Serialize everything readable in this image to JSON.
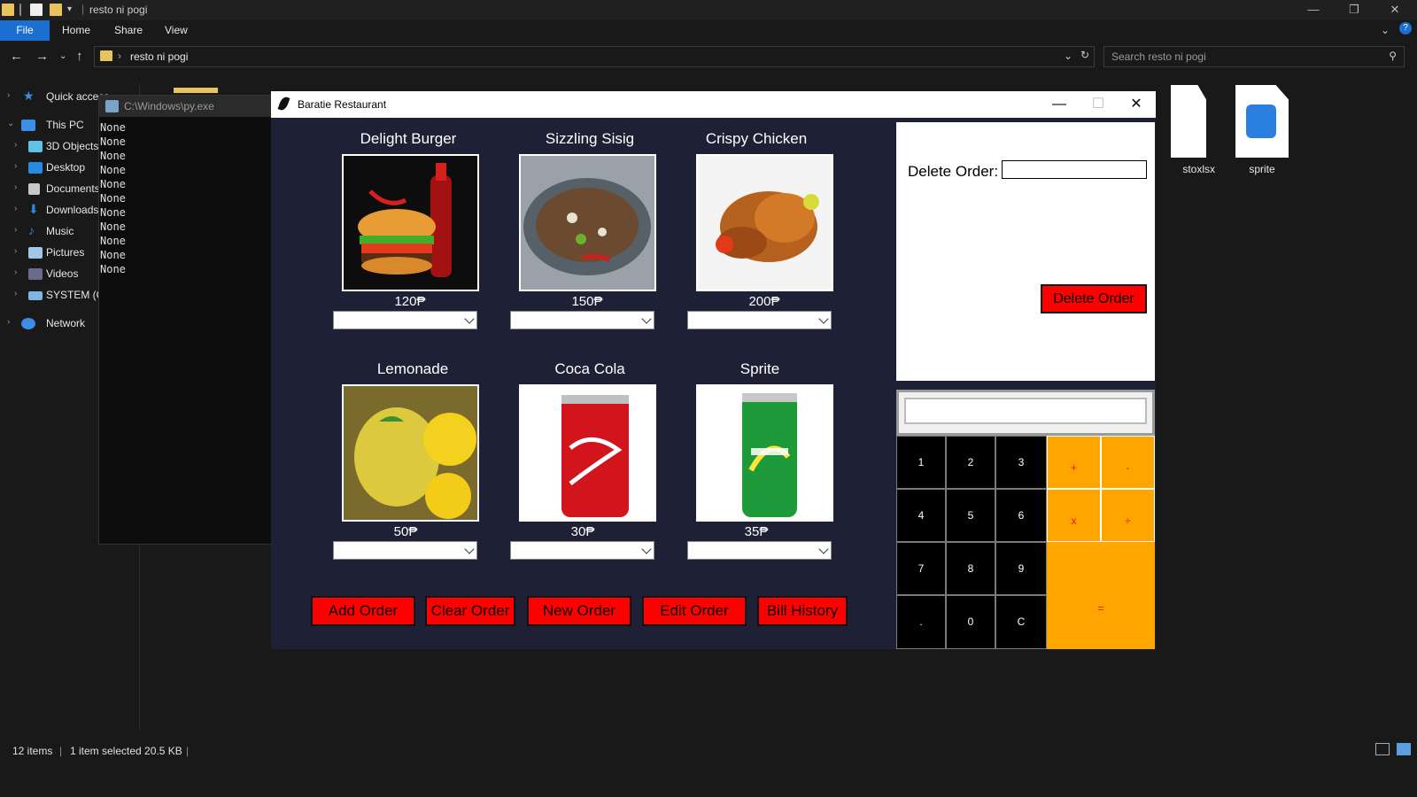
{
  "explorer": {
    "title": "resto ni pogi",
    "tabs": {
      "file": "File",
      "home": "Home",
      "share": "Share",
      "view": "View"
    },
    "address": "resto ni pogi",
    "search_placeholder": "Search resto ni pogi",
    "nav": {
      "quick_access": "Quick access",
      "this_pc": "This PC",
      "objects3d": "3D Objects",
      "desktop": "Desktop",
      "documents": "Documents",
      "downloads": "Downloads",
      "music": "Music",
      "pictures": "Pictures",
      "videos": "Videos",
      "system": "SYSTEM (C:",
      "network": "Network"
    },
    "files": {
      "partial_label": "stoxlsx",
      "sprite_label": "sprite"
    },
    "status": {
      "count": "12 items",
      "selected": "1 item selected  20.5 KB"
    }
  },
  "console": {
    "title": "C:\\Windows\\py.exe",
    "lines": [
      "None",
      "None",
      "None",
      "None",
      "None",
      "None",
      "None",
      "None",
      "None",
      "None",
      "None"
    ]
  },
  "app": {
    "title": "Baratie Restaurant",
    "items": [
      {
        "name": "Delight Burger",
        "price": "120₱"
      },
      {
        "name": "Sizzling Sisig",
        "price": "150₱"
      },
      {
        "name": "Crispy Chicken",
        "price": "200₱"
      },
      {
        "name": "Lemonade",
        "price": "50₱"
      },
      {
        "name": "Coca Cola",
        "price": "30₱"
      },
      {
        "name": "Sprite",
        "price": "35₱"
      }
    ],
    "buttons": {
      "add": "Add Order",
      "clear": "Clear Order",
      "new": "New Order",
      "edit": "Edit Order",
      "history": "Bill History"
    },
    "delete": {
      "label": "Delete Order:",
      "button": "Delete Order"
    },
    "calculator": {
      "keys": [
        "1",
        "2",
        "3",
        "4",
        "5",
        "6",
        "7",
        "8",
        "9",
        ".",
        "0",
        "C"
      ],
      "ops": [
        "+",
        "-",
        "x",
        "÷",
        "="
      ]
    }
  },
  "colors": {
    "app_bg": "#1e2135",
    "button_red": "#ff0000",
    "calc_orange": "#ffa500",
    "explorer_bg": "#191919"
  }
}
